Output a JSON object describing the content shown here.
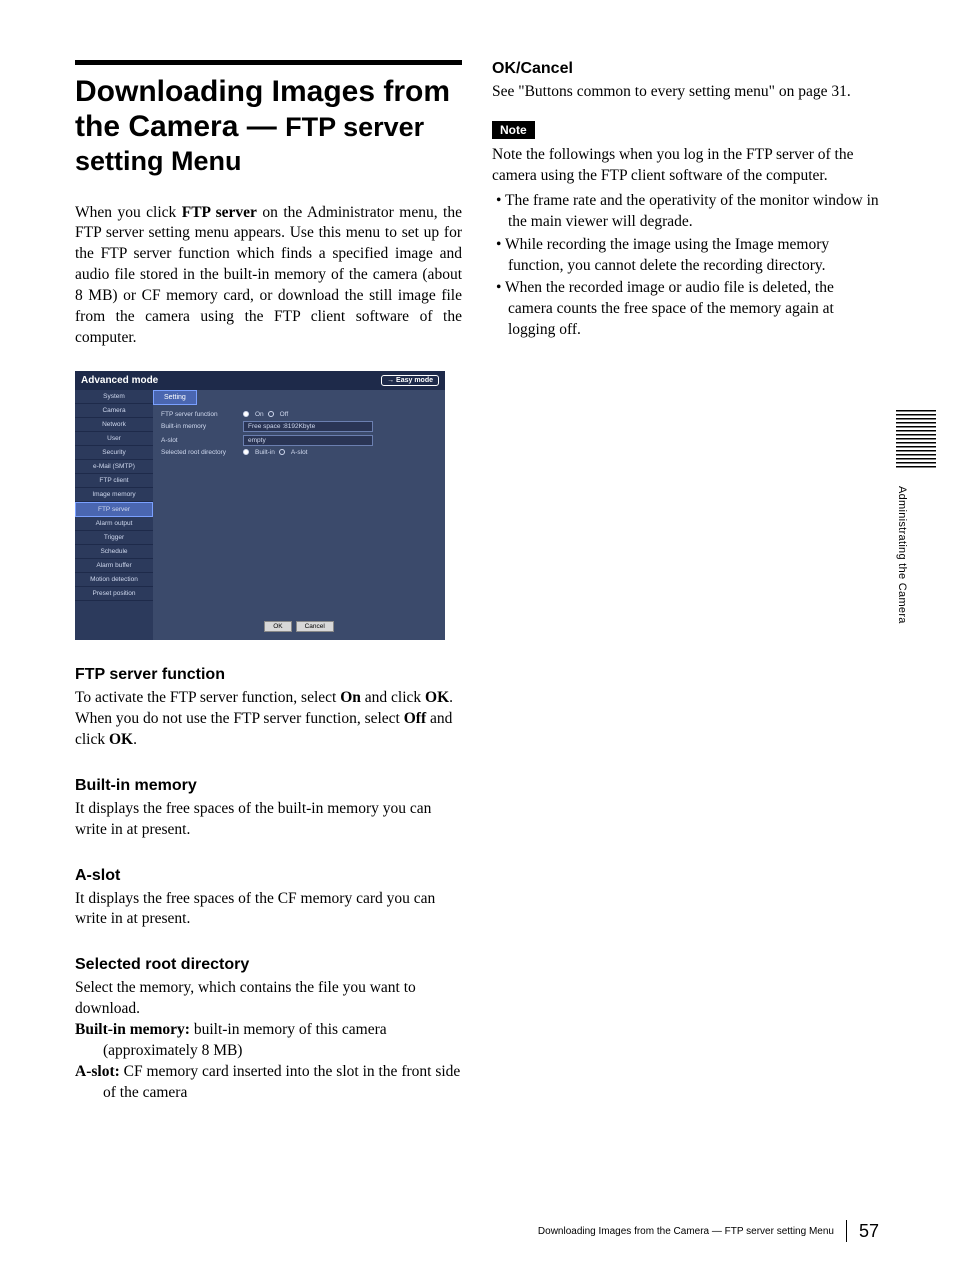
{
  "title_part1": "Downloading Images from the Camera",
  "title_dash": " — ",
  "title_ftp": "FTP server setting Menu",
  "intro_p1a": "When you click ",
  "intro_p1b": "FTP server",
  "intro_p1c": " on the Administrator menu, the FTP server setting menu appears. Use this menu to set up for the FTP server function which finds a specified image and audio file stored in the built-in memory of the camera (about 8 MB) or CF memory card, or download the still image file from the camera using the FTP client software of the computer.",
  "shot": {
    "mode": "Advanced mode",
    "easy": "→ Easy mode",
    "nav": [
      "System",
      "Camera",
      "Network",
      "User",
      "Security",
      "e-Mail (SMTP)",
      "FTP client",
      "Image memory",
      "FTP server",
      "Alarm output",
      "Trigger",
      "Schedule",
      "Alarm buffer",
      "Motion detection",
      "Preset position"
    ],
    "tab": "Setting",
    "row_func": "FTP server function",
    "on": "On",
    "off": "Off",
    "row_mem": "Built-in memory",
    "mem_val": "Free space :8192Kbyte",
    "row_aslot": "A-slot",
    "aslot_val": "empty",
    "row_root": "Selected root directory",
    "root_builtin": "Built-in",
    "root_aslot": "A-slot",
    "ok": "OK",
    "cancel": "Cancel"
  },
  "sec_ftp_h": "FTP server function",
  "sec_ftp_p1a": "To activate the FTP server function, select ",
  "sec_ftp_p1b": "On",
  "sec_ftp_p1c": " and click ",
  "sec_ftp_p1d": "OK",
  "sec_ftp_p1e": ".",
  "sec_ftp_p2a": "When you do not use the FTP server function, select ",
  "sec_ftp_p2b": "Off",
  "sec_ftp_p2c": " and click ",
  "sec_ftp_p2d": "OK",
  "sec_ftp_p2e": ".",
  "sec_mem_h": "Built-in memory",
  "sec_mem_p": "It displays the free spaces of the built-in memory you can write in at present.",
  "sec_aslot_h": "A-slot",
  "sec_aslot_p": "It displays the free spaces of the CF memory card you can write in at present.",
  "sec_root_h": "Selected root directory",
  "sec_root_p": "Select the memory, which contains the file you want to download.",
  "root_def1_t": "Built-in memory:",
  "root_def1_d": " built-in memory of this camera (approximately 8 MB)",
  "root_def2_t": "A-slot:",
  "root_def2_d": " CF memory card inserted into the slot in the front side of the camera",
  "col2_ok_h": "OK/Cancel",
  "col2_ok_p": "See \"Buttons common to every setting menu\" on page 31.",
  "note_label": "Note",
  "note_intro": "Note the followings when you log in the FTP server of the camera using the FTP client software of the computer.",
  "note_b1": "The frame rate and the operativity of the monitor window in the main viewer will degrade.",
  "note_b2": "While recording the image using the Image memory function, you cannot delete the recording directory.",
  "note_b3": "When the recorded image or audio file is deleted, the camera counts the free space of the memory again at logging off.",
  "side": "Administrating the Camera",
  "footer_text": "Downloading Images from the Camera — FTP server setting Menu",
  "page_no": "57"
}
